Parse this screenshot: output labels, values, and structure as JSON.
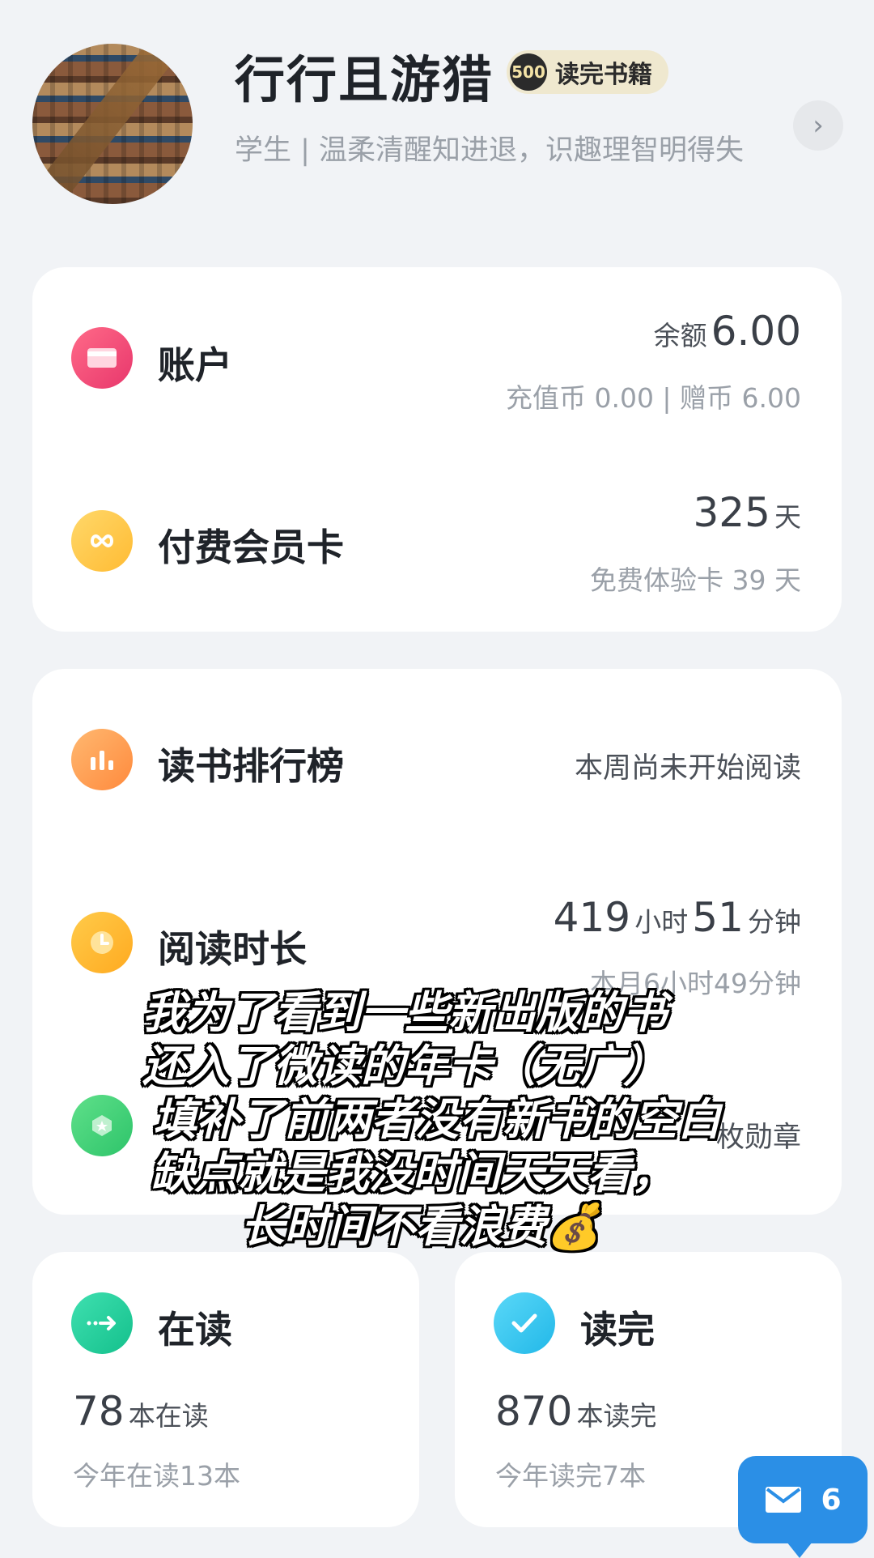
{
  "profile": {
    "name": "行行且游猎",
    "badge_number": "500",
    "badge_label": "读完书籍",
    "bio": "学生 | 温柔清醒知进退，识趣理智明得失"
  },
  "account": {
    "title": "账户",
    "balance_label": "余额",
    "balance_value": "6.00",
    "detail": "充值币 0.00 | 赠币 6.00"
  },
  "membership": {
    "title": "付费会员卡",
    "days_value": "325",
    "days_unit": "天",
    "trial": "免费体验卡 39 天"
  },
  "ranking": {
    "title": "读书排行榜",
    "status": "本周尚未开始阅读"
  },
  "reading_time": {
    "title": "阅读时长",
    "hours": "419",
    "hours_unit": "小时",
    "minutes": "51",
    "minutes_unit": "分钟",
    "this_month": "本月6小时49分钟"
  },
  "medals": {
    "partial_text": "枚勋章"
  },
  "reading": {
    "title": "在读",
    "count": "78",
    "count_unit": "本在读",
    "this_year": "今年在读13本"
  },
  "finished": {
    "title": "读完",
    "count": "870",
    "count_unit": "本读完",
    "this_year": "今年读完7本"
  },
  "overlay_caption": [
    "我为了看到一些新出版的书",
    "还入了微读的年卡（无广）",
    "填补了前两者没有新书的空白",
    "缺点就是我没时间天天看，",
    "长时间不看浪费💰"
  ],
  "mail": {
    "count": "6"
  },
  "colors": {
    "background": "#f1f3f6",
    "account_icon": "#f0507a",
    "membership_icon": "#ffc94a",
    "ranking_icon": "#ff9a4a",
    "time_icon": "#ffb830",
    "medal_icon": "#3fd07a",
    "reading_icon": "#1fd0a0",
    "finished_icon": "#30c8ef",
    "mail_button": "#2b8fe6"
  }
}
